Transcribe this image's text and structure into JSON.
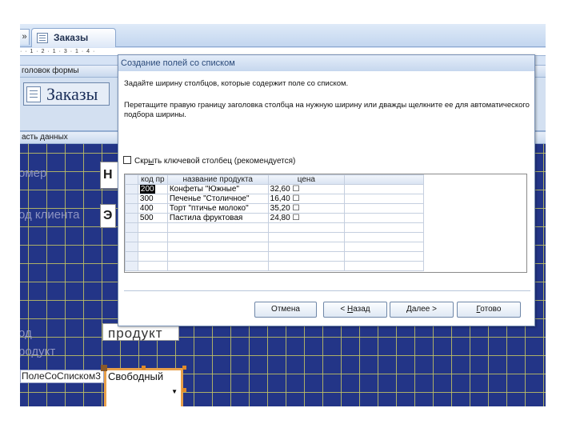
{
  "document_tab": {
    "prev_tab_glyph": "»",
    "title": "Заказы"
  },
  "ruler": {
    "marks": "· · 1 · 2 · 1 · 3 · 1 · 4 ·"
  },
  "form_header_band": "головок формы",
  "form_header_title": "Заказы",
  "detail_band": "асть данных",
  "form_fields": {
    "nomer_label": "омер",
    "nomer_value": "Н",
    "client_label": "од клиента",
    "client_value": "Э",
    "product_label_line1": "од",
    "product_label_line2": "родукт",
    "product_box": "продукт",
    "combo_label": "ПолеСоСписком3",
    "combo_value": "Свободный"
  },
  "wizard": {
    "title": "Создание полей со списком",
    "instruction1": "Задайте ширину столбцов, которые содержит поле со списком.",
    "instruction2": "Перетащите правую границу заголовка столбца на нужную ширину или дважды щелкните ее для автоматического подбора ширины.",
    "hide_key_checkbox": {
      "label_pre": "Скр",
      "label_under": "ы",
      "label_post": "ть ключевой столбец (рекомендуется)",
      "checked": false
    },
    "columns": [
      "код пр",
      "название продукта",
      "цена"
    ],
    "rows": [
      [
        "200",
        "Конфеты \"Южные\"",
        "32,60 ☐"
      ],
      [
        "300",
        "Печенье \"Столичное\"",
        "16,40 ☐"
      ],
      [
        "400",
        "Торт \"птичье молоко\"",
        "35,20 ☐"
      ],
      [
        "500",
        "Пастила фруктовая",
        "24,80 ☐"
      ]
    ],
    "buttons": {
      "cancel": "Отмена",
      "back_pre": "< ",
      "back_under": "Н",
      "back_post": "азад",
      "next_under": "Д",
      "next_post": "алее >",
      "finish_under": "Г",
      "finish_post": "отово"
    }
  },
  "colors": {
    "detail_background": "#233587",
    "grid_lines": "#c4c462",
    "selection_handles": "#e08a2a",
    "dialog_chrome": "#d4e0f0"
  }
}
